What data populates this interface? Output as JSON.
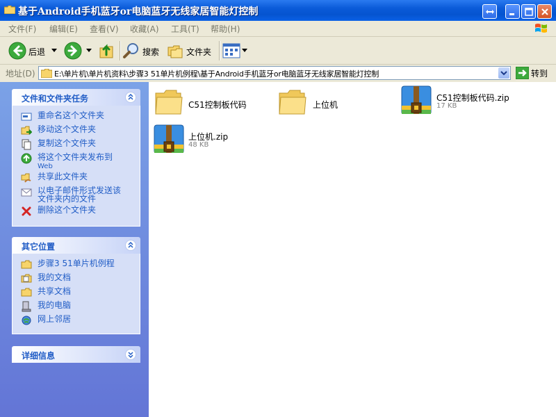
{
  "window": {
    "title": "基于Android手机蓝牙or电脑蓝牙无线家居智能灯控制"
  },
  "menu": [
    {
      "label": "文件(F)"
    },
    {
      "label": "编辑(E)"
    },
    {
      "label": "查看(V)"
    },
    {
      "label": "收藏(A)"
    },
    {
      "label": "工具(T)"
    },
    {
      "label": "帮助(H)"
    }
  ],
  "toolbar": {
    "back_label": "后退",
    "search_label": "搜索",
    "folders_label": "文件夹"
  },
  "address": {
    "label": "地址(D)",
    "path": "E:\\单片机\\单片机资料\\步骤3 51单片机例程\\基于Android手机蓝牙or电脑蓝牙无线家居智能灯控制",
    "go_label": "转到"
  },
  "left_pane": {
    "tasks_title": "文件和文件夹任务",
    "tasks": [
      {
        "label": "重命名这个文件夹",
        "icon": "rename-icon"
      },
      {
        "label": "移动这个文件夹",
        "icon": "move-icon"
      },
      {
        "label": "复制这个文件夹",
        "icon": "copy-icon"
      },
      {
        "label": "将这个文件夹发布到",
        "label2": "Web",
        "icon": "publish-web-icon"
      },
      {
        "label": "共享此文件夹",
        "icon": "share-icon"
      },
      {
        "label": "以电子邮件形式发送该",
        "label2": "文件夹内的文件",
        "icon": "email-icon"
      },
      {
        "label": "删除这个文件夹",
        "icon": "delete-icon"
      }
    ],
    "places_title": "其它位置",
    "places": [
      {
        "label": "步骤3 51单片机例程",
        "icon": "folder-icon"
      },
      {
        "label": "我的文档",
        "icon": "my-documents-icon"
      },
      {
        "label": "共享文档",
        "icon": "shared-documents-icon"
      },
      {
        "label": "我的电脑",
        "icon": "my-computer-icon"
      },
      {
        "label": "网上邻居",
        "icon": "network-icon"
      }
    ],
    "details_title": "详细信息"
  },
  "files": [
    {
      "name": "C51控制板代码",
      "type": "folder"
    },
    {
      "name": "上位机",
      "type": "folder"
    },
    {
      "name": "C51控制板代码.zip",
      "size": "17 KB",
      "type": "zip"
    },
    {
      "name": "上位机.zip",
      "size": "48 KB",
      "type": "zip"
    }
  ],
  "colors": {
    "titlebar": "#0554D0",
    "task_link": "#215DC6",
    "left_pane": "#7BA2E7"
  }
}
